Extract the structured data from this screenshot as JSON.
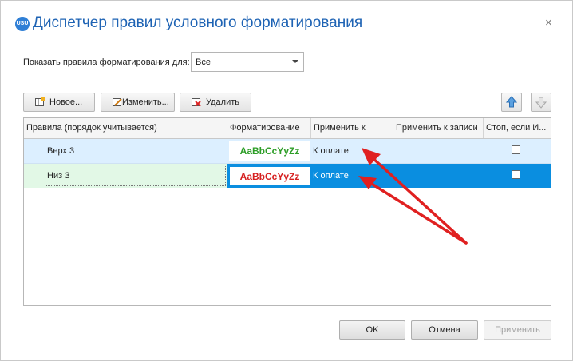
{
  "window": {
    "logo_text": "USU",
    "title": "Диспетчер правил условного форматирования",
    "close_glyph": "×"
  },
  "filter": {
    "label": "Показать правила форматирования для:",
    "value": "Все"
  },
  "toolbar": {
    "new_label": "Новое...",
    "edit_label": "Изменить...",
    "delete_label": "Удалить"
  },
  "grid": {
    "columns": [
      "Правила (порядок учитывается)",
      "Форматирование",
      "Применить к",
      "Применить к записи",
      "Стоп, если И..."
    ],
    "rows": [
      {
        "rule": "Верх 3",
        "format_preview": "AaBbCcYyZz",
        "format_color": "#2e9e28",
        "apply_to": "К оплате",
        "apply_to_record": "",
        "stop": false
      },
      {
        "rule": "Низ 3",
        "format_preview": "AaBbCcYyZz",
        "format_color": "#d62020",
        "apply_to": "К оплате",
        "apply_to_record": "",
        "stop": false
      }
    ]
  },
  "buttons": {
    "ok": "OK",
    "cancel": "Отмена",
    "apply": "Применить"
  },
  "colors": {
    "accent": "#1e63b4",
    "row1_bg": "#dcefff",
    "row2_selected": "#0a8ee0",
    "row2_rule_bg": "#e2f8e6",
    "annotation_arrow": "#e02020"
  }
}
